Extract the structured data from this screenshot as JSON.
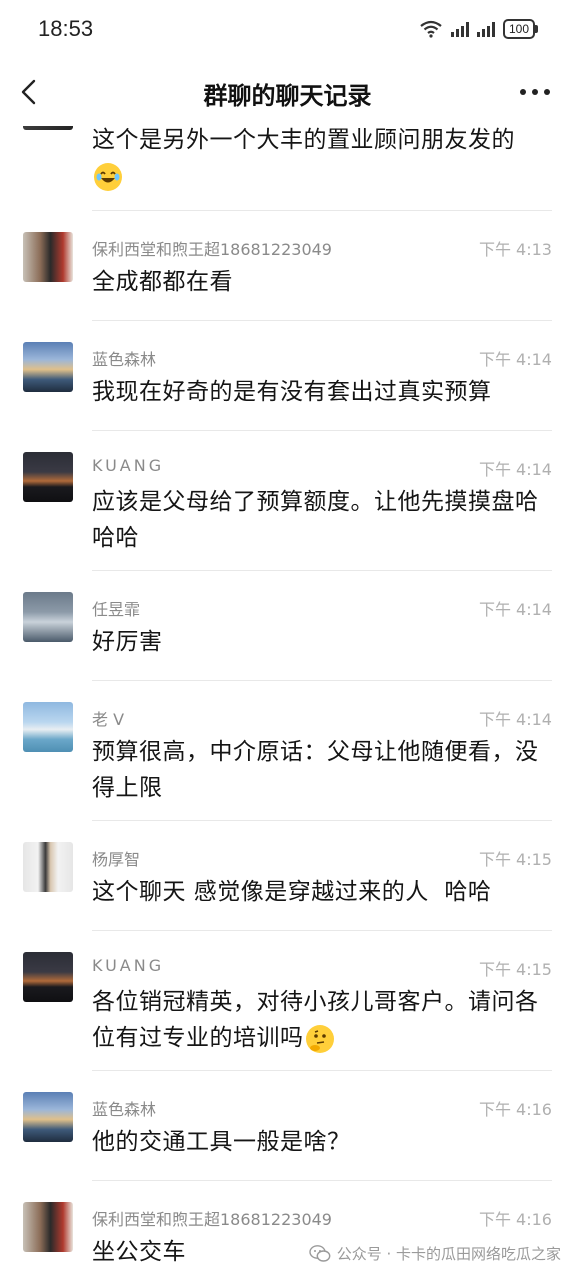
{
  "status_bar": {
    "time": "18:53",
    "battery": "100"
  },
  "header": {
    "title": "群聊的聊天记录"
  },
  "messages": [
    {
      "name": "",
      "time": "",
      "text": "这个是另外一个大丰的置业顾问朋友发的"
    },
    {
      "name": "保利西堂和煦王超18681223049",
      "time": "下午 4:13",
      "text": "全成都都在看"
    },
    {
      "name": "蓝色森林",
      "time": "下午 4:14",
      "text": "我现在好奇的是有没有套出过真实预算"
    },
    {
      "name": "KUANG",
      "time": "下午 4:14",
      "text": "应该是父母给了预算额度。让他先摸摸盘哈哈哈"
    },
    {
      "name": "任昱霏",
      "time": "下午 4:14",
      "text": "好厉害"
    },
    {
      "name": "老 V",
      "time": "下午 4:14",
      "text": "预算很高，中介原话：父母让他随便看，没得上限"
    },
    {
      "name": "杨厚智",
      "time": "下午 4:15",
      "text": "这个聊天 感觉像是穿越过来的人  哈哈"
    },
    {
      "name": "KUANG",
      "time": "下午 4:15",
      "text": "各位销冠精英，对待小孩儿哥客户。请问各位有过专业的培训吗"
    },
    {
      "name": "蓝色森林",
      "time": "下午 4:16",
      "text": "他的交通工具一般是啥？"
    },
    {
      "name": "保利西堂和煦王超18681223049",
      "time": "下午 4:16",
      "text": "坐公交车"
    }
  ],
  "watermark": {
    "text": "公众号 · 卡卡的瓜田网络吃瓜之家"
  }
}
